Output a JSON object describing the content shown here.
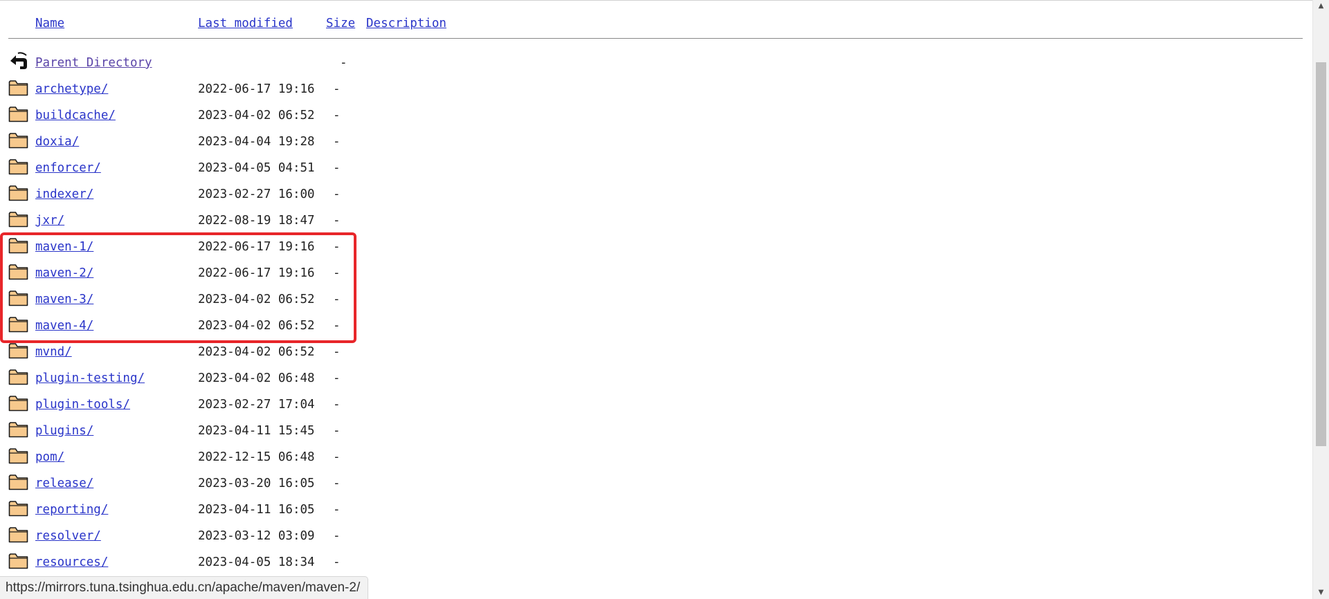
{
  "columns": {
    "name": "Name",
    "last_modified": "Last modified",
    "size": "Size",
    "description": "Description"
  },
  "parent": {
    "label": "Parent Directory",
    "size": "-",
    "icon": "back-arrow-icon"
  },
  "entries": [
    {
      "name": "archetype/",
      "modified": "2022-06-17 19:16",
      "size": "-"
    },
    {
      "name": "buildcache/",
      "modified": "2023-04-02 06:52",
      "size": "-"
    },
    {
      "name": "doxia/",
      "modified": "2023-04-04 19:28",
      "size": "-"
    },
    {
      "name": "enforcer/",
      "modified": "2023-04-05 04:51",
      "size": "-"
    },
    {
      "name": "indexer/",
      "modified": "2023-02-27 16:00",
      "size": "-"
    },
    {
      "name": "jxr/",
      "modified": "2022-08-19 18:47",
      "size": "-"
    },
    {
      "name": "maven-1/",
      "modified": "2022-06-17 19:16",
      "size": "-"
    },
    {
      "name": "maven-2/",
      "modified": "2022-06-17 19:16",
      "size": "-"
    },
    {
      "name": "maven-3/",
      "modified": "2023-04-02 06:52",
      "size": "-"
    },
    {
      "name": "maven-4/",
      "modified": "2023-04-02 06:52",
      "size": "-"
    },
    {
      "name": "mvnd/",
      "modified": "2023-04-02 06:52",
      "size": "-"
    },
    {
      "name": "plugin-testing/",
      "modified": "2023-04-02 06:48",
      "size": "-"
    },
    {
      "name": "plugin-tools/",
      "modified": "2023-02-27 17:04",
      "size": "-"
    },
    {
      "name": "plugins/",
      "modified": "2023-04-11 15:45",
      "size": "-"
    },
    {
      "name": "pom/",
      "modified": "2022-12-15 06:48",
      "size": "-"
    },
    {
      "name": "release/",
      "modified": "2023-03-20 16:05",
      "size": "-"
    },
    {
      "name": "reporting/",
      "modified": "2023-04-11 16:05",
      "size": "-"
    },
    {
      "name": "resolver/",
      "modified": "2023-03-12 03:09",
      "size": "-"
    },
    {
      "name": "resources/",
      "modified": "2023-04-05 18:34",
      "size": "-"
    }
  ],
  "folder_icon": "folder-icon",
  "highlight_color": "#e8262a",
  "link_color": "#2a35c9",
  "status_bar": {
    "url": "https://mirrors.tuna.tsinghua.edu.cn/apache/maven/maven-2/"
  }
}
